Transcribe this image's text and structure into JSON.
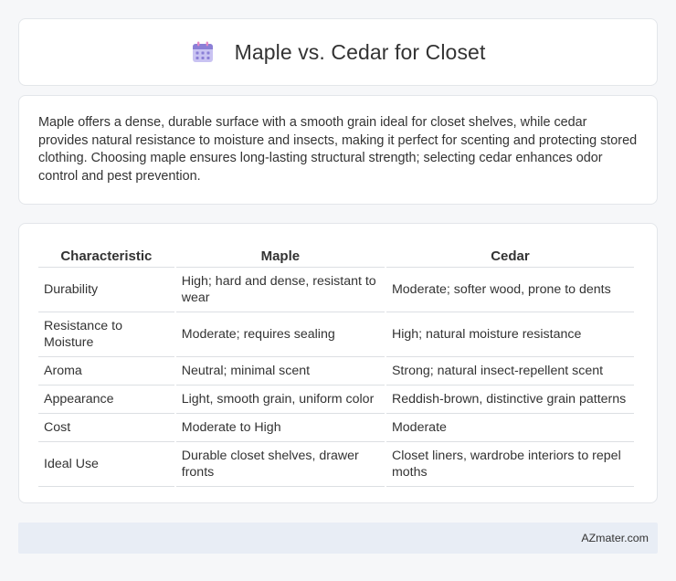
{
  "header": {
    "icon": "calendar-icon",
    "title": "Maple vs. Cedar for Closet"
  },
  "intro": {
    "text": "Maple offers a dense, durable surface with a smooth grain ideal for closet shelves, while cedar provides natural resistance to moisture and insects, making it perfect for scenting and protecting stored clothing. Choosing maple ensures long-lasting structural strength; selecting cedar enhances odor control and pest prevention."
  },
  "table": {
    "headers": [
      "Characteristic",
      "Maple",
      "Cedar"
    ],
    "rows": [
      [
        "Durability",
        "High; hard and dense, resistant to wear",
        "Moderate; softer wood, prone to dents"
      ],
      [
        "Resistance to Moisture",
        "Moderate; requires sealing",
        "High; natural moisture resistance"
      ],
      [
        "Aroma",
        "Neutral; minimal scent",
        "Strong; natural insect-repellent scent"
      ],
      [
        "Appearance",
        "Light, smooth grain, uniform color",
        "Reddish-brown, distinctive grain patterns"
      ],
      [
        "Cost",
        "Moderate to High",
        "Moderate"
      ],
      [
        "Ideal Use",
        "Durable closet shelves, drawer fronts",
        "Closet liners, wardrobe interiors to repel moths"
      ]
    ]
  },
  "footer": {
    "text": "AZmater.com"
  },
  "colors": {
    "background": "#f6f7f9",
    "card": "#ffffff",
    "footer_bg": "#e8edf5",
    "icon_purple": "#8b7fd6",
    "icon_pink": "#e58ac4"
  }
}
